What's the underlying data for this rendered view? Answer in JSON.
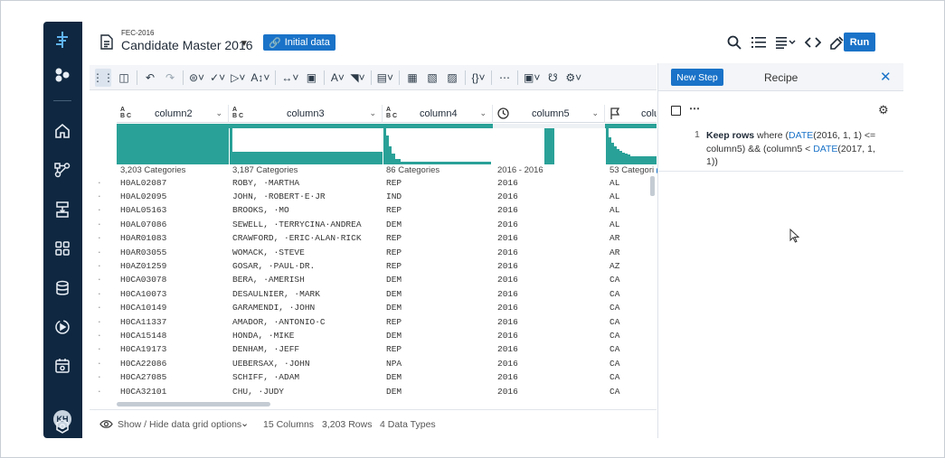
{
  "header": {
    "project_label": "FEC-2016",
    "title": "Candidate Master 2016",
    "tag_label": "Initial data",
    "run_label": "Run"
  },
  "user": {
    "initials": "KH"
  },
  "columns": [
    {
      "name": "column2",
      "type": "ABC",
      "summary": "3,203 Categories"
    },
    {
      "name": "column3",
      "type": "ABC",
      "summary": "3,187 Categories"
    },
    {
      "name": "column4",
      "type": "ABC",
      "summary": "86 Categories"
    },
    {
      "name": "column5",
      "type": "date",
      "summary": "2016 - 2016"
    },
    {
      "name": "colu",
      "type": "flag",
      "summary": "53 Categori"
    }
  ],
  "rows": [
    [
      "H0AL02087",
      "ROBY, ·MARTHA",
      "REP",
      "2016",
      "AL"
    ],
    [
      "H0AL02095",
      "JOHN, ·ROBERT·E·JR",
      "IND",
      "2016",
      "AL"
    ],
    [
      "H0AL05163",
      "BROOKS, ·MO",
      "REP",
      "2016",
      "AL"
    ],
    [
      "H0AL07086",
      "SEWELL, ·TERRYCINA·ANDREA",
      "DEM",
      "2016",
      "AL"
    ],
    [
      "H0AR01083",
      "CRAWFORD, ·ERIC·ALAN·RICK",
      "REP",
      "2016",
      "AR"
    ],
    [
      "H0AR03055",
      "WOMACK, ·STEVE",
      "REP",
      "2016",
      "AR"
    ],
    [
      "H0AZ01259",
      "GOSAR, ·PAUL·DR.",
      "REP",
      "2016",
      "AZ"
    ],
    [
      "H0CA03078",
      "BERA, ·AMERISH",
      "DEM",
      "2016",
      "CA"
    ],
    [
      "H0CA10073",
      "DESAULNIER, ·MARK",
      "DEM",
      "2016",
      "CA"
    ],
    [
      "H0CA10149",
      "GARAMENDI, ·JOHN",
      "DEM",
      "2016",
      "CA"
    ],
    [
      "H0CA11337",
      "AMADOR, ·ANTONIO·C",
      "REP",
      "2016",
      "CA"
    ],
    [
      "H0CA15148",
      "HONDA, ·MIKE",
      "DEM",
      "2016",
      "CA"
    ],
    [
      "H0CA19173",
      "DENHAM, ·JEFF",
      "REP",
      "2016",
      "CA"
    ],
    [
      "H0CA22086",
      "UEBERSAX, ·JOHN",
      "NPA",
      "2016",
      "CA"
    ],
    [
      "H0CA27085",
      "SCHIFF, ·ADAM",
      "DEM",
      "2016",
      "CA"
    ],
    [
      "H0CA32101",
      "CHU, ·JUDY",
      "DEM",
      "2016",
      "CA"
    ]
  ],
  "footer": {
    "grid_options": "Show / Hide data grid options",
    "columns_count": "15 Columns",
    "rows_count": "3,203 Rows",
    "types_count": "4 Data Types"
  },
  "recipe": {
    "new_step_label": "New Step",
    "title": "Recipe",
    "step_number": "1",
    "step_verb": "Keep rows",
    "step_where": " where ",
    "step_fn1": "DATE",
    "step_args1": "(2016, 1, 1) <= column5) && (column5 < ",
    "step_fn2": "DATE",
    "step_args2": "(2017, 1, 1))"
  },
  "colors": {
    "accent": "#1a73c8",
    "histogram": "#2aa198",
    "nav": "#0f2740"
  }
}
